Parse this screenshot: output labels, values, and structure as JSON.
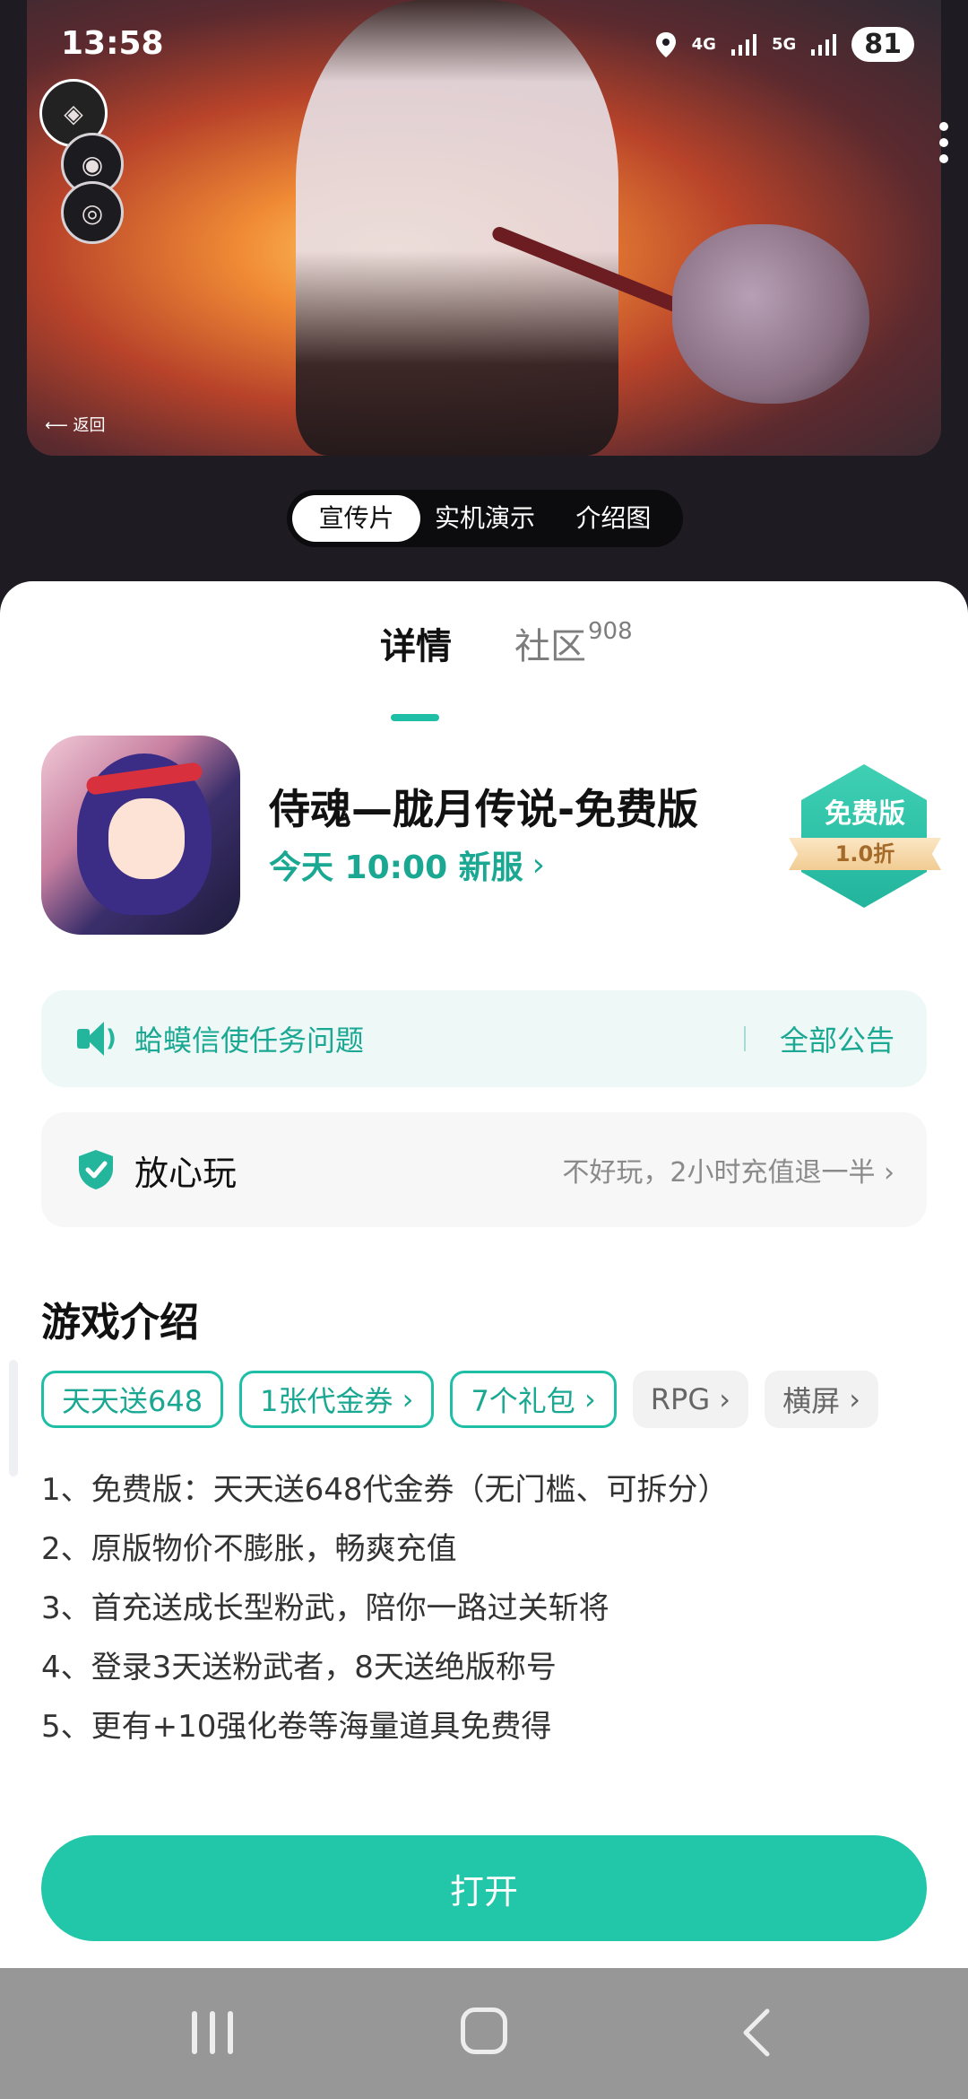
{
  "status_bar": {
    "time": "13:58",
    "network_4g": "4G",
    "network_5g": "5G",
    "battery": "81"
  },
  "video": {
    "back_label": "返回"
  },
  "media_tabs": [
    "宣传片",
    "实机演示",
    "介绍图"
  ],
  "main_tabs": {
    "details": "详情",
    "community": "社区",
    "community_count": "908"
  },
  "game": {
    "title": "侍魂—胧月传说-免费版",
    "server_info": "今天 10:00 新服",
    "badge_label": "免费版",
    "badge_discount": "1.0折"
  },
  "notice": {
    "text": "蛤蟆信使任务问题",
    "all_label": "全部公告"
  },
  "safe_play": {
    "label": "放心玩",
    "desc": "不好玩，2小时充值退一半"
  },
  "intro": {
    "title": "游戏介绍",
    "tags": [
      {
        "label": "天天送648",
        "style": "green",
        "arrow": false
      },
      {
        "label": "1张代金券",
        "style": "green",
        "arrow": true
      },
      {
        "label": "7个礼包",
        "style": "green",
        "arrow": true
      },
      {
        "label": "RPG",
        "style": "gray",
        "arrow": true
      },
      {
        "label": "横屏",
        "style": "gray",
        "arrow": true
      }
    ],
    "lines": [
      "1、免费版：天天送648代金券（无门槛、可拆分）",
      "2、原版物价不膨胀，畅爽充值",
      "3、首充送成长型粉武，陪你一路过关斩将",
      "4、登录3天送粉武者，8天送绝版称号",
      "5、更有+10强化卷等海量道具免费得"
    ]
  },
  "open_button": "打开",
  "colors": {
    "accent": "#22c6a8",
    "accent_text": "#1aa893",
    "notice_bg": "#eef8f6"
  }
}
